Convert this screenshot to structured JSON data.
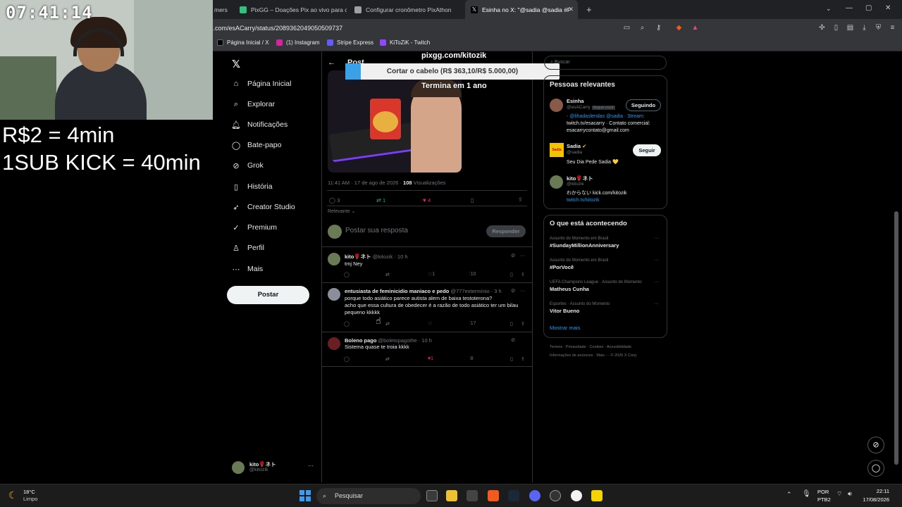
{
  "browser": {
    "tabs": [
      {
        "label": "mers",
        "active": false,
        "color": "#888"
      },
      {
        "label": "PixGG – Doações Pix ao vivo para c",
        "active": false,
        "color": "#2ec27e"
      },
      {
        "label": "Configurar cronômetro PixAthon",
        "active": false,
        "color": "#9aa0a6"
      },
      {
        "label": "Esinha no X: \"@sadia @sadia #F",
        "active": true,
        "color": "#ffffff"
      }
    ],
    "new_tab": "+",
    "url": "x.com/esACarry/status/2089362049050509737",
    "bookmarks": [
      "Página Inicial / X",
      "(1) Instagram",
      "Stripe Express",
      "KiToZiK - Twitch"
    ]
  },
  "stream": {
    "clock": "07:41:14",
    "rate1": "R$2 = 4min",
    "rate2": "1SUB KICK = 40min",
    "pix_url": "pixgg.com/kitozik",
    "goal_label": "Cortar o cabelo (R$ 363,10/R$ 5.000,00)",
    "goal_fraction": 0.0726,
    "ends": "Termina em 1 ano"
  },
  "nav": {
    "items": [
      "Página Inicial",
      "Explorar",
      "Notificações",
      "Bate-papo",
      "Grok",
      "História",
      "Creator Studio",
      "Premium",
      "Perfil",
      "Mais"
    ],
    "post_button": "Postar",
    "account_name": "kito🌹ネト",
    "account_handle": "@kitozik",
    "more": "···"
  },
  "post": {
    "header": "Post",
    "meta": "11:41 AM · 17 de ago de 2026 ·",
    "views_count": "108",
    "views_label": "Visualizações",
    "replies": "3",
    "reposts": "1",
    "likes": "4",
    "relevance": "Relevante",
    "reply_placeholder": "Postar sua resposta",
    "reply_button": "Responder"
  },
  "replies": [
    {
      "name": "kito🌹ネト",
      "handle": "@kitozik · 10 h",
      "text": "tmj Ney",
      "likes": "1",
      "views": "10"
    },
    {
      "name": "entusiasta de feminicidio maniaco e pedo",
      "handle": "@777extermínio · 3 h",
      "text": "porque todo asiático parece autista alem de baixa testoterona?",
      "text2": "acho que essa cultura de obedecer é a razão de todo asiático ter um bilau",
      "text3": "pequeno kkkkk",
      "likes": "",
      "views": "17"
    },
    {
      "name": "Boleno pago",
      "handle": "@boletopagothe · 10 h",
      "text": "Sistema quase te troia kkkk",
      "likes": "1",
      "views": "8"
    }
  ],
  "sidebar": {
    "search_placeholder": "Buscar",
    "people_title": "Pessoas relevantes",
    "people": [
      {
        "name": "Esinha",
        "handle": "@esACarry",
        "badge": "Segue você",
        "button": "Seguindo",
        "bio1": "- @lihadaslendas @sadia · Stream:",
        "bio2": "twitch.tv/esacarry · Contato comercial:",
        "bio3": "esacarrycontato@gmail.com"
      },
      {
        "name": "Sadia",
        "handle": "@sadia",
        "button": "Seguir",
        "bio1": "Seu Dia Pede Sadia 💛"
      },
      {
        "name": "kito🌹ネト",
        "handle": "@kitozik",
        "bio1": "わからない kick.com/kitozik",
        "bio2": "twitch.tv/kitozik"
      }
    ],
    "trends_title": "O que está acontecendo",
    "trends": [
      {
        "context": "Assunto do Momento em Brasil",
        "topic": "#SundayMillionAnniversary"
      },
      {
        "context": "Assunto do Momento em Brasil",
        "topic": "#PorVocê"
      },
      {
        "context": "UEFA Champions League · Assunto do Momento",
        "topic": "Matheus Cunha"
      },
      {
        "context": "Esportes · Assunto do Momento",
        "topic": "Vitor Bueno"
      }
    ],
    "show_more": "Mostrar mais",
    "footer1": "Termos  ·  Privacidade  ·  Cookies  ·  Acessibilidade",
    "footer2": "Informações de anúncios  ·  Mais ···  © 2026 X Corp."
  },
  "taskbar": {
    "weather_temp": "18°C",
    "weather_desc": "Limpo",
    "search": "Pesquisar",
    "lang1": "POR",
    "lang2": "PTB2",
    "time": "22:11",
    "date": "17/08/2026"
  }
}
